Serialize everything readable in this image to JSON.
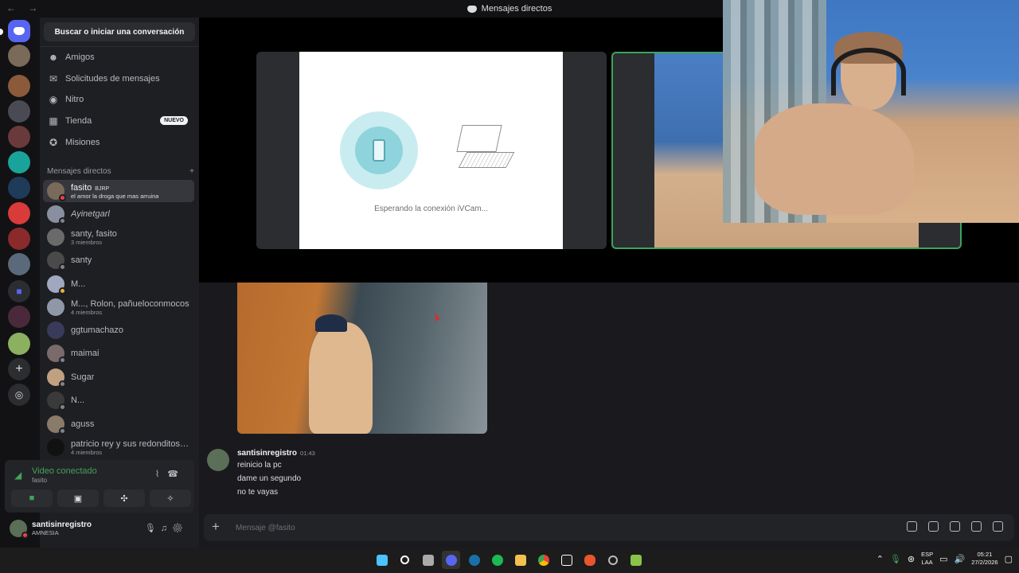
{
  "window": {
    "title": "Mensajes directos",
    "nav": "← →"
  },
  "sidebar": {
    "search_label": "Buscar o iniciar una conversación",
    "nav": [
      {
        "label": "Amigos",
        "icon": "friends-icon"
      },
      {
        "label": "Solicitudes de mensajes",
        "icon": "envelope-icon"
      },
      {
        "label": "Nitro",
        "icon": "nitro-icon"
      },
      {
        "label": "Tienda",
        "icon": "shop-icon",
        "badge": "NUEVO"
      },
      {
        "label": "Misiones",
        "icon": "quests-icon"
      }
    ],
    "dm_header": "Mensajes directos",
    "dm_add": "+",
    "dms": [
      {
        "name": "fasito",
        "tag": "BJRP",
        "sub": "el amor la droga que mas arruina",
        "active": true
      },
      {
        "name": "Ayinetgarl",
        "sub": ""
      },
      {
        "name": "santy, fasito",
        "sub": "3 miembros"
      },
      {
        "name": "santy",
        "sub": ""
      },
      {
        "name": "M...",
        "sub": ""
      },
      {
        "name": "M..., Rolon, pañueloconmocos",
        "sub": "4 miembros"
      },
      {
        "name": "ggtumachazo",
        "sub": ""
      },
      {
        "name": "maimai",
        "sub": ""
      },
      {
        "name": "Sugar",
        "sub": ""
      },
      {
        "name": "N...",
        "sub": ""
      },
      {
        "name": "aguss",
        "sub": ""
      },
      {
        "name": "patricio rey y sus redonditos d...",
        "sub": "4 miembros"
      }
    ]
  },
  "voice": {
    "status": "Video conectado",
    "channel": "fasito"
  },
  "user": {
    "name": "santisinregistro",
    "status": "AMNESIA"
  },
  "stage": {
    "waiting_text": "Esperando la conexión iVCam..."
  },
  "chat": {
    "author": "santisinregistro",
    "time": "01:43",
    "lines": [
      "reinicio la pc",
      "dame un segundo",
      "no te vayas"
    ],
    "composer_placeholder": "Mensaje @fasito",
    "composer_plus": "+"
  },
  "taskbar": {
    "lang_top": "ESP",
    "lang_bottom": "LAA",
    "time": "05:21",
    "date": "27/2/2026"
  },
  "colors": {
    "accent": "#5865f2",
    "online": "#43a25a",
    "dnd": "#f23f43"
  }
}
